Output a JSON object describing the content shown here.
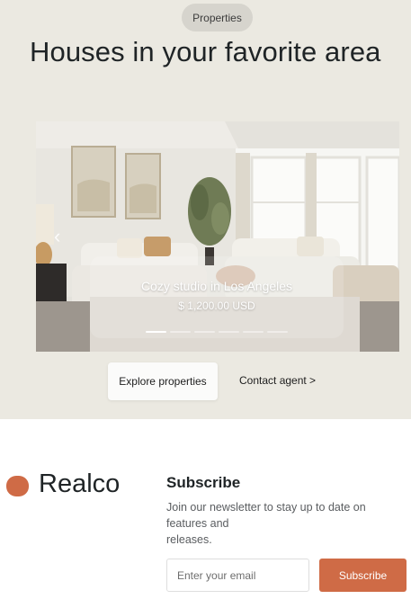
{
  "hero": {
    "badge": "Properties",
    "headline": "Houses in your favorite area"
  },
  "carousel": {
    "prev_icon": "chevron-left-icon",
    "slide": {
      "title": "Cozy studio in Los Angeles",
      "price": "$ 1,200.00 USD"
    },
    "dots_count": 6,
    "active_index": 0
  },
  "actions": {
    "explore_label": "Explore properties",
    "contact_label": "Contact agent >"
  },
  "footer": {
    "brand": "Realco",
    "subscribe_title": "Subscribe",
    "subscribe_desc_line1": "Join our newsletter to stay up to date on",
    "subscribe_desc_line2": "features and",
    "subscribe_desc_line3": "releases.",
    "email_placeholder": "Enter your email",
    "subscribe_button": "Subscribe"
  },
  "colors": {
    "hero_bg": "#ebe9e1",
    "accent": "#cf6b46"
  }
}
